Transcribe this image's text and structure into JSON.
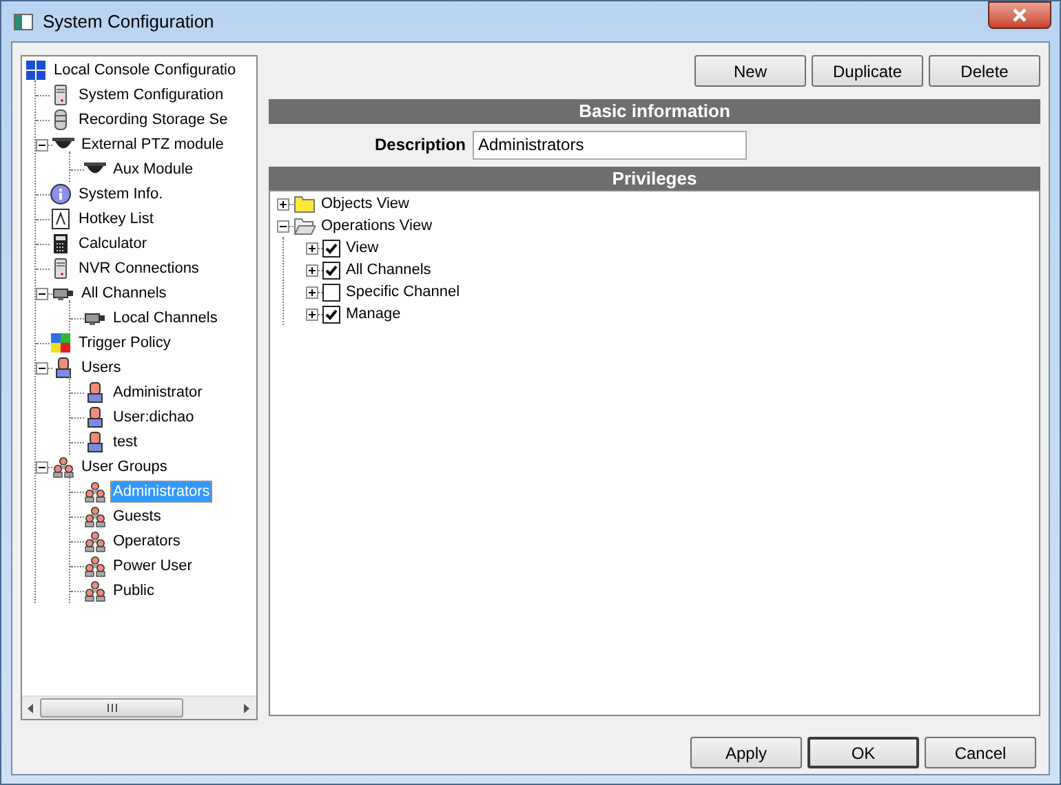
{
  "window": {
    "title": "System Configuration"
  },
  "sidebar": {
    "tree": [
      {
        "label": "Local Console Configuratio",
        "kind": "grid",
        "selected": false,
        "children": [
          {
            "label": "System Configuration",
            "kind": "server",
            "selected": false
          },
          {
            "label": "Recording Storage Se",
            "kind": "storage",
            "selected": false
          },
          {
            "label": "External PTZ module",
            "kind": "camera",
            "selected": false,
            "expanded": true,
            "children": [
              {
                "label": "Aux Module",
                "kind": "camera",
                "selected": false
              }
            ]
          },
          {
            "label": "System Info.",
            "kind": "info",
            "selected": false
          },
          {
            "label": "Hotkey List",
            "kind": "key",
            "selected": false
          },
          {
            "label": "Calculator",
            "kind": "calc",
            "selected": false
          },
          {
            "label": "NVR Connections",
            "kind": "server",
            "selected": false
          },
          {
            "label": "All Channels",
            "kind": "channel",
            "selected": false,
            "expanded": true,
            "children": [
              {
                "label": "Local Channels",
                "kind": "channel",
                "selected": false
              }
            ]
          },
          {
            "label": "Trigger Policy",
            "kind": "trigger",
            "selected": false
          },
          {
            "label": "Users",
            "kind": "user",
            "selected": false,
            "expanded": true,
            "children": [
              {
                "label": "Administrator",
                "kind": "user",
                "selected": false
              },
              {
                "label": "User:dichao",
                "kind": "user",
                "selected": false
              },
              {
                "label": "test",
                "kind": "user",
                "selected": false
              }
            ]
          },
          {
            "label": "User Groups",
            "kind": "group",
            "selected": false,
            "expanded": true,
            "children": [
              {
                "label": "Administrators",
                "kind": "group",
                "selected": true
              },
              {
                "label": "Guests",
                "kind": "group",
                "selected": false
              },
              {
                "label": "Operators",
                "kind": "group",
                "selected": false
              },
              {
                "label": "Power User",
                "kind": "group",
                "selected": false
              },
              {
                "label": "Public",
                "kind": "group",
                "selected": false
              }
            ]
          }
        ]
      }
    ]
  },
  "toolbar": [
    "New",
    "Duplicate",
    "Delete"
  ],
  "basic_information": {
    "heading": "Basic information",
    "description_label": "Description",
    "description_value": "Administrators"
  },
  "privileges": {
    "heading": "Privileges",
    "tree": [
      {
        "label": "Objects View",
        "expanded": false
      },
      {
        "label": "Operations View",
        "expanded": true,
        "children": [
          {
            "label": "View",
            "expanded": false,
            "checked": true
          },
          {
            "label": "All Channels",
            "expanded": false,
            "checked": true
          },
          {
            "label": "Specific Channel",
            "expanded": false,
            "checked": false
          },
          {
            "label": "Manage",
            "expanded": false,
            "checked": true
          }
        ]
      }
    ]
  },
  "buttons": [
    {
      "label": "Apply",
      "default": false
    },
    {
      "label": "OK",
      "default": true
    },
    {
      "label": "Cancel",
      "default": false
    }
  ]
}
